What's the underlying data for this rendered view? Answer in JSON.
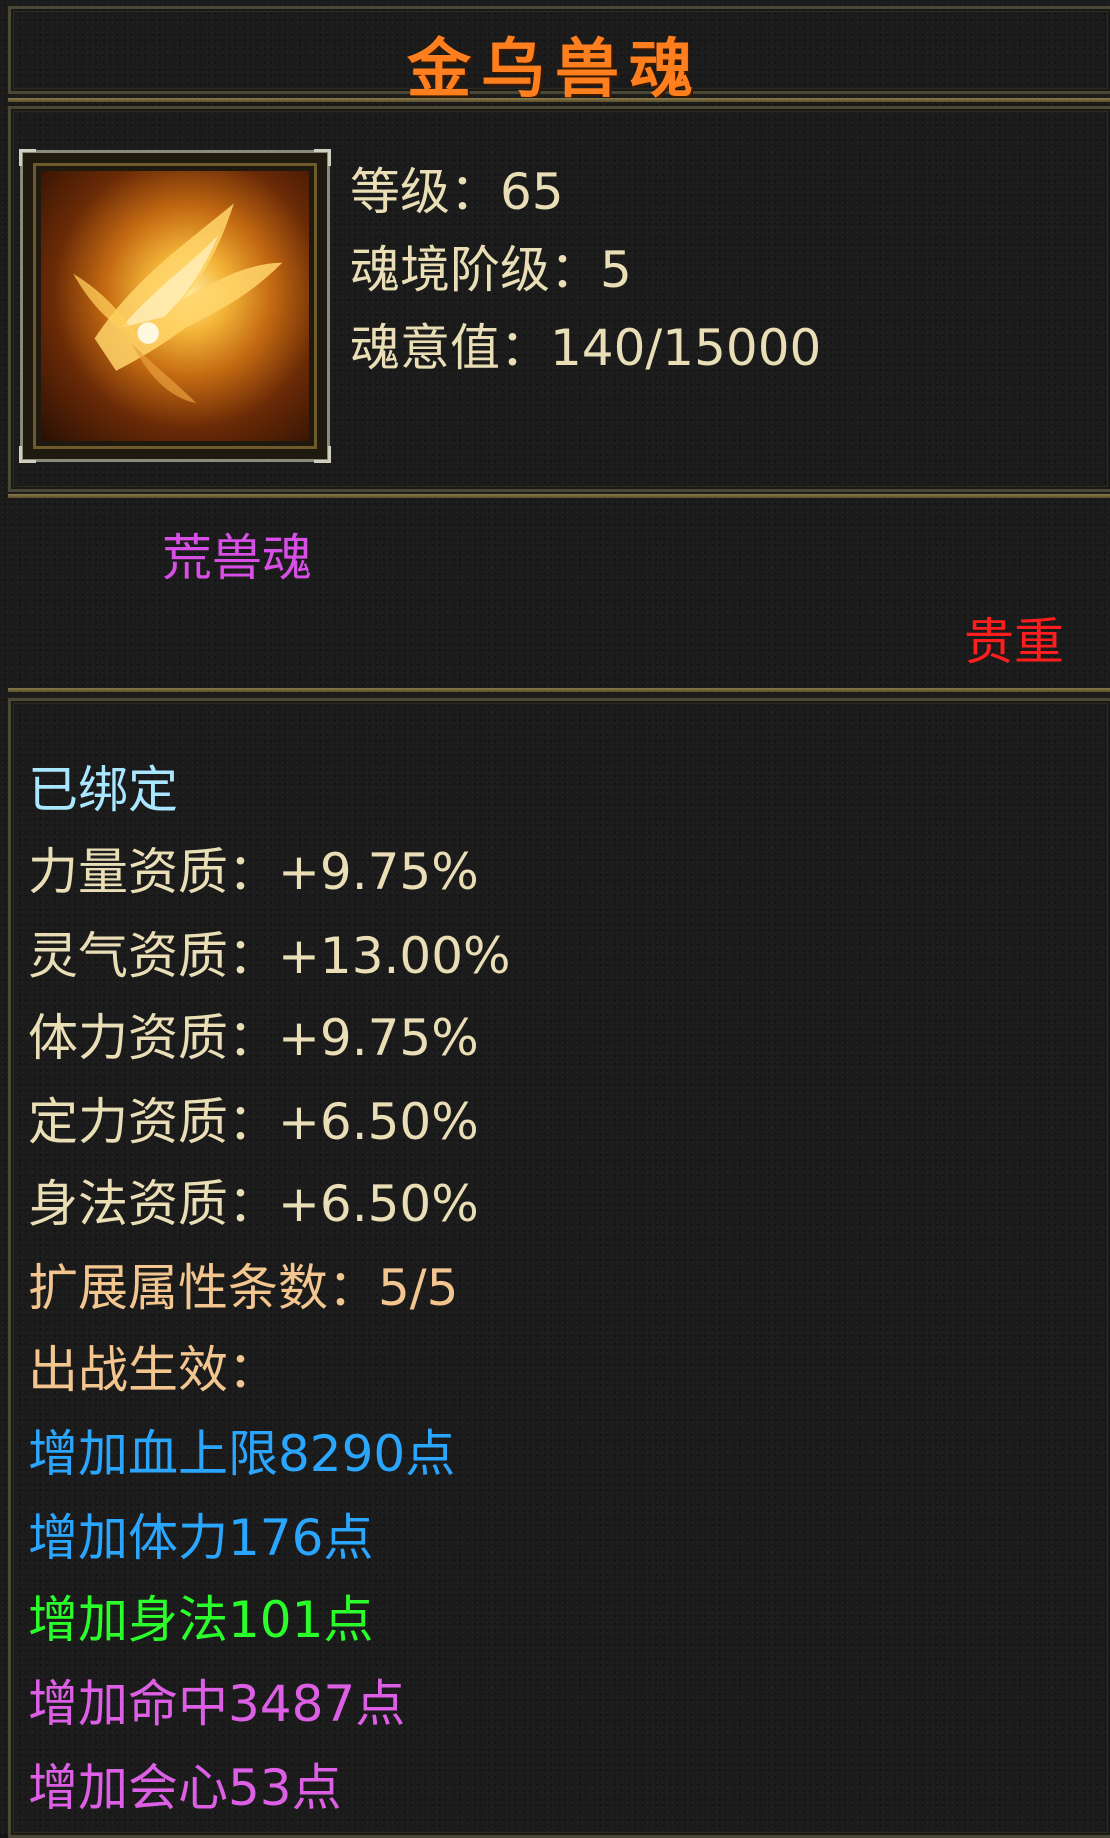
{
  "title": "金乌兽魂",
  "stats": {
    "level_label": "等级：",
    "level_value": "65",
    "realm_label": "魂境阶级：",
    "realm_value": "5",
    "soul_label": "魂意值：",
    "soul_value": "140/15000"
  },
  "category": "荒兽魂",
  "rarity": "贵重",
  "bound": "已绑定",
  "aptitudes": [
    {
      "label": "力量资质：",
      "value": "+9.75%"
    },
    {
      "label": "灵气资质：",
      "value": "+13.00%"
    },
    {
      "label": "体力资质：",
      "value": "+9.75%"
    },
    {
      "label": "定力资质：",
      "value": "+6.50%"
    },
    {
      "label": "身法资质：",
      "value": "+6.50%"
    }
  ],
  "extended": {
    "label": "扩展属性条数：",
    "value": "5/5"
  },
  "battle_label": "出战生效：",
  "bonuses": [
    {
      "text": "增加血上限8290点",
      "color": "#2ba6ff"
    },
    {
      "text": "增加体力176点",
      "color": "#2ba6ff"
    },
    {
      "text": "增加身法101点",
      "color": "#2bff2b"
    },
    {
      "text": "增加命中3487点",
      "color": "#dd5fe6"
    },
    {
      "text": "增加会心53点",
      "color": "#dd5fe6"
    }
  ],
  "icon": "golden-crow-phoenix-icon"
}
